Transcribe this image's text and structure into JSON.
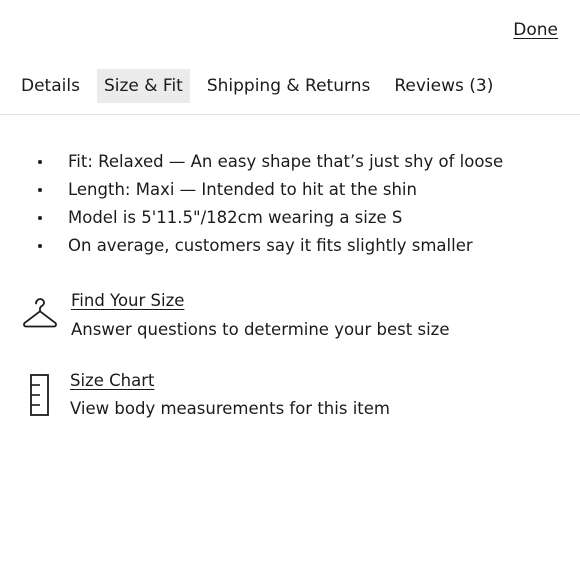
{
  "header": {
    "done_label": "Done"
  },
  "tabs": [
    {
      "label": "Details",
      "active": false
    },
    {
      "label": "Size & Fit",
      "active": true
    },
    {
      "label": "Shipping & Returns",
      "active": false
    },
    {
      "label": "Reviews (3)",
      "active": false
    }
  ],
  "fit_details": [
    "Fit: Relaxed — An easy shape that’s just shy of loose",
    "Length: Maxi — Intended to hit at the shin",
    "Model is 5'11.5\"/182cm wearing a size S",
    "On average, customers say it fits slightly smaller"
  ],
  "find_your_size": {
    "icon": "hanger-icon",
    "link_label": "Find Your Size",
    "description": "Answer questions to determine your best size"
  },
  "size_chart": {
    "icon": "ruler-icon",
    "link_label": "Size Chart",
    "description": "View body measurements for this item"
  }
}
